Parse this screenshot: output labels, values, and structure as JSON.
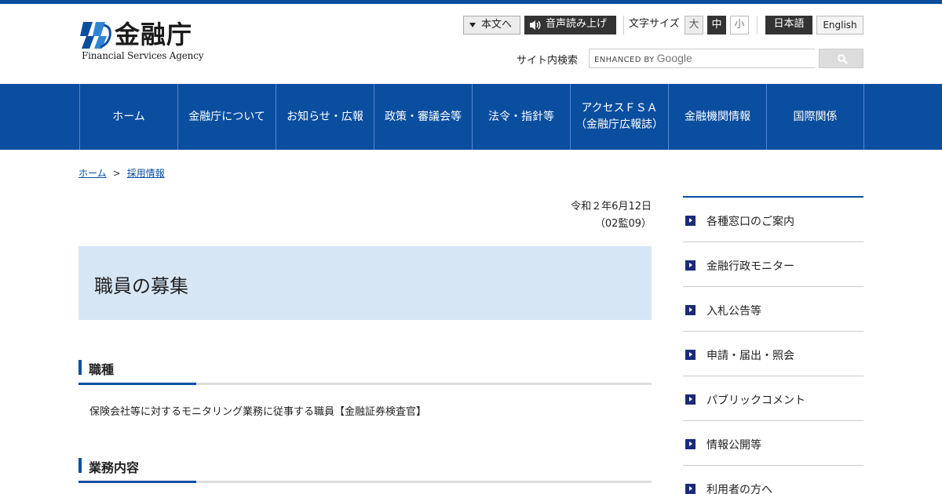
{
  "header": {
    "logo_jp": "金融庁",
    "logo_en": "Financial Services Agency",
    "skip_label": "本文へ",
    "voice_label": "音声読み上げ",
    "font_size_label": "文字サイズ",
    "font_sizes": [
      "大",
      "中",
      "小"
    ],
    "lang_ja": "日本語",
    "lang_en": "English",
    "search_label": "サイト内検索",
    "search_placeholder_enhanced": "ENHANCED BY",
    "search_placeholder_google": "Google"
  },
  "nav": [
    "ホーム",
    "金融庁について",
    "お知らせ・広報",
    "政策・審議会等",
    "法令・指針等",
    "アクセスＦＳＡ\n（金融庁広報誌）",
    "金融機関情報",
    "国際関係"
  ],
  "breadcrumb": [
    "ホーム",
    "採用情報"
  ],
  "breadcrumb_sep": ">",
  "main": {
    "date": "令和２年6月12日",
    "doc_no": "（02監09）",
    "title": "職員の募集",
    "sections": [
      {
        "heading": "職種",
        "body": "保険会社等に対するモニタリング業務に従事する職員【金融証券検査官】"
      },
      {
        "heading": "業務内容"
      }
    ]
  },
  "side_nav": [
    "各種窓口のご案内",
    "金融行政モニター",
    "入札公告等",
    "申請・届出・照会",
    "パブリックコメント",
    "情報公開等",
    "利用者の方へ"
  ],
  "colors": {
    "brand": "#0a4ea0",
    "title_bg": "#d6e6f5"
  }
}
